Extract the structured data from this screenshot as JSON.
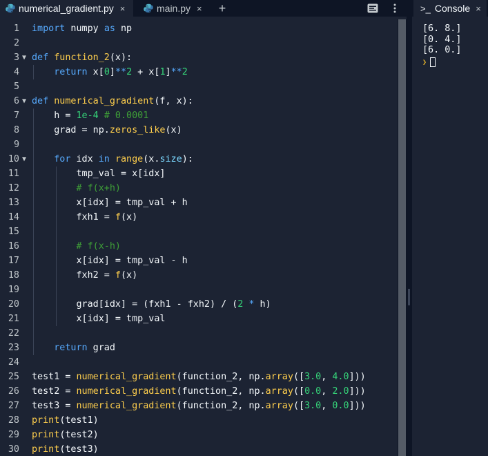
{
  "tabs": [
    {
      "label": "numerical_gradient.py",
      "active": true
    },
    {
      "label": "main.py",
      "active": false
    }
  ],
  "tab_close_glyph": "×",
  "add_tab_glyph": "+",
  "code_lines": [
    [
      [
        "kw",
        "import"
      ],
      [
        "p",
        " numpy "
      ],
      [
        "kw",
        "as"
      ],
      [
        "p",
        " np"
      ]
    ],
    [],
    [
      [
        "kw",
        "def"
      ],
      [
        "p",
        " "
      ],
      [
        "fn",
        "function_2"
      ],
      [
        "p",
        "(x):"
      ]
    ],
    [
      [
        "p",
        "    "
      ],
      [
        "kw",
        "return"
      ],
      [
        "p",
        " x["
      ],
      [
        "num",
        "0"
      ],
      [
        "p",
        "]"
      ],
      [
        "op",
        "**"
      ],
      [
        "num",
        "2"
      ],
      [
        "p",
        " + x["
      ],
      [
        "num",
        "1"
      ],
      [
        "p",
        "]"
      ],
      [
        "op",
        "**"
      ],
      [
        "num",
        "2"
      ]
    ],
    [],
    [
      [
        "kw",
        "def"
      ],
      [
        "p",
        " "
      ],
      [
        "fn",
        "numerical_gradient"
      ],
      [
        "p",
        "(f, x):"
      ]
    ],
    [
      [
        "p",
        "    h = "
      ],
      [
        "num",
        "1e-4"
      ],
      [
        "p",
        " "
      ],
      [
        "cm",
        "# 0.0001"
      ]
    ],
    [
      [
        "p",
        "    grad = np."
      ],
      [
        "fn",
        "zeros_like"
      ],
      [
        "p",
        "(x)"
      ]
    ],
    [],
    [
      [
        "p",
        "    "
      ],
      [
        "kw",
        "for"
      ],
      [
        "p",
        " idx "
      ],
      [
        "kw",
        "in"
      ],
      [
        "p",
        " "
      ],
      [
        "fn",
        "range"
      ],
      [
        "p",
        "(x."
      ],
      [
        "attr",
        "size"
      ],
      [
        "p",
        "):"
      ]
    ],
    [
      [
        "p",
        "        tmp_val = x[idx]"
      ]
    ],
    [
      [
        "p",
        "        "
      ],
      [
        "cm",
        "# f(x+h)"
      ]
    ],
    [
      [
        "p",
        "        x[idx] = tmp_val + h"
      ]
    ],
    [
      [
        "p",
        "        fxh1 = "
      ],
      [
        "fn",
        "f"
      ],
      [
        "p",
        "(x)"
      ]
    ],
    [],
    [
      [
        "p",
        "        "
      ],
      [
        "cm",
        "# f(x-h)"
      ]
    ],
    [
      [
        "p",
        "        x[idx] = tmp_val - h"
      ]
    ],
    [
      [
        "p",
        "        fxh2 = "
      ],
      [
        "fn",
        "f"
      ],
      [
        "p",
        "(x)"
      ]
    ],
    [],
    [
      [
        "p",
        "        grad[idx] = (fxh1 - fxh2) / ("
      ],
      [
        "num",
        "2"
      ],
      [
        "p",
        " "
      ],
      [
        "op",
        "*"
      ],
      [
        "p",
        " h)"
      ]
    ],
    [
      [
        "p",
        "        x[idx] = tmp_val"
      ]
    ],
    [],
    [
      [
        "p",
        "    "
      ],
      [
        "kw",
        "return"
      ],
      [
        "p",
        " grad"
      ]
    ],
    [],
    [
      [
        "p",
        "test1 = "
      ],
      [
        "fn",
        "numerical_gradient"
      ],
      [
        "p",
        "(function_2, np."
      ],
      [
        "fn",
        "array"
      ],
      [
        "p",
        "(["
      ],
      [
        "num",
        "3.0"
      ],
      [
        "p",
        ", "
      ],
      [
        "num",
        "4.0"
      ],
      [
        "p",
        "]))"
      ]
    ],
    [
      [
        "p",
        "test2 = "
      ],
      [
        "fn",
        "numerical_gradient"
      ],
      [
        "p",
        "(function_2, np."
      ],
      [
        "fn",
        "array"
      ],
      [
        "p",
        "(["
      ],
      [
        "num",
        "0.0"
      ],
      [
        "p",
        ", "
      ],
      [
        "num",
        "2.0"
      ],
      [
        "p",
        "]))"
      ]
    ],
    [
      [
        "p",
        "test3 = "
      ],
      [
        "fn",
        "numerical_gradient"
      ],
      [
        "p",
        "(function_2, np."
      ],
      [
        "fn",
        "array"
      ],
      [
        "p",
        "(["
      ],
      [
        "num",
        "3.0"
      ],
      [
        "p",
        ", "
      ],
      [
        "num",
        "0.0"
      ],
      [
        "p",
        "]))"
      ]
    ],
    [
      [
        "fn",
        "print"
      ],
      [
        "p",
        "(test1)"
      ]
    ],
    [
      [
        "fn",
        "print"
      ],
      [
        "p",
        "(test2)"
      ]
    ],
    [
      [
        "fn",
        "print"
      ],
      [
        "p",
        "(test3)"
      ]
    ]
  ],
  "fold_markers": {
    "3": "▼",
    "6": "▼",
    "10": "▼"
  },
  "console": {
    "tab_label": "Console",
    "tab_icon_glyph": ">_",
    "close_glyph": "×",
    "output": [
      "[6. 8.]",
      "[0. 4.]",
      "[6. 0.]"
    ],
    "prompt_glyph": "❯"
  },
  "colors": {
    "background": "#1c2333",
    "tabbar": "#0e1525",
    "keyword": "#57abff",
    "function": "#ffcf4d",
    "number": "#36d67a",
    "comment": "#3fa037",
    "text": "#f5f9fc",
    "python_icon_blue": "#3774a7",
    "python_icon_teal": "#4fb0c6"
  }
}
